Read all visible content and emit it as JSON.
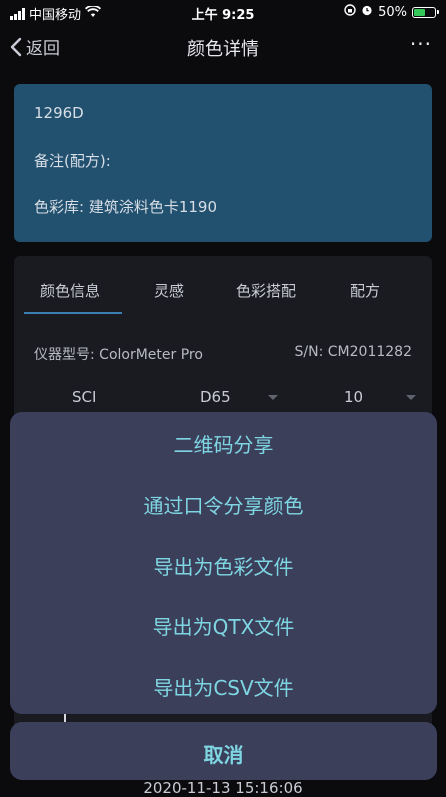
{
  "status_bar": {
    "carrier": "中国移动",
    "time": "上午 9:25",
    "battery_percent": "50%",
    "battery_level": 0.5,
    "icons": [
      "signal-icon",
      "wifi-icon",
      "orientation-lock-icon",
      "alarm-icon",
      "battery-charging-icon"
    ]
  },
  "nav": {
    "back_label": "返回",
    "title": "颜色详情",
    "more_label": "···"
  },
  "color_card": {
    "code": "1296D",
    "note_label": "备注(配方):",
    "library_label": "色彩库: 建筑涂料色卡1190",
    "background": "#22506f"
  },
  "info_tabs": [
    {
      "label": "颜色信息",
      "active": true
    },
    {
      "label": "灵感",
      "active": false
    },
    {
      "label": "色彩搭配",
      "active": false
    },
    {
      "label": "配方",
      "active": false
    }
  ],
  "device": {
    "model_label": "仪器型号:",
    "model_value": "ColorMeter Pro",
    "sn_label": "S/N:",
    "sn_value": "CM2011282"
  },
  "measure_options": {
    "mode": "SCI",
    "illuminant": "D65",
    "observer": "10"
  },
  "action_sheet": {
    "items": [
      "二维码分享",
      "通过口令分享颜色",
      "导出为色彩文件",
      "导出为QTX文件",
      "导出为CSV文件"
    ],
    "cancel_label": "取消",
    "accent": "#7fd6e3"
  },
  "footer": {
    "timestamp": "2020-11-13 15:16:06"
  }
}
